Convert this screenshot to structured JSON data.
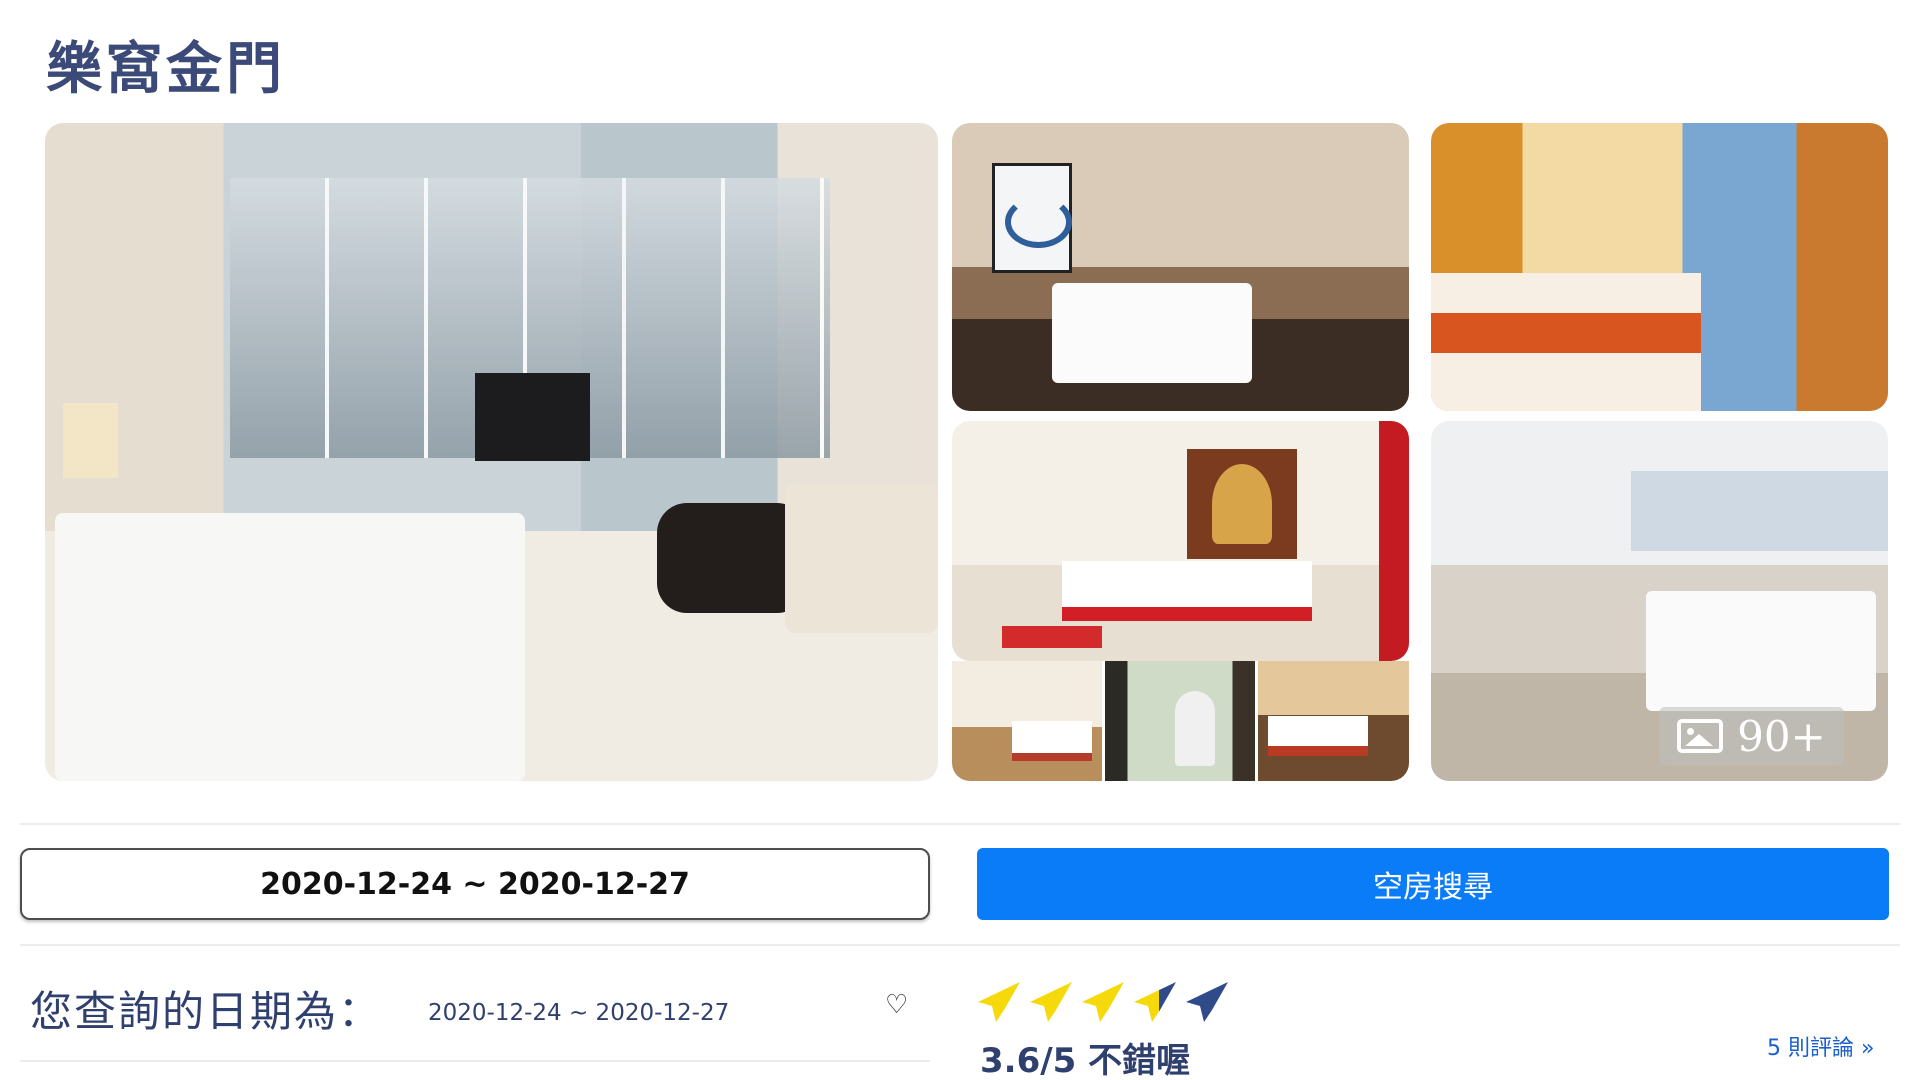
{
  "hotel": {
    "name": "樂窩金門"
  },
  "gallery": {
    "main_photo": "bedroom-city-view",
    "more_count": "90+"
  },
  "search": {
    "date_range": "2020-12-24 ~ 2020-12-27",
    "button_label": "空房搜尋"
  },
  "query": {
    "label": "您查詢的日期為：",
    "range": "2020-12-24 ~ 2020-12-27"
  },
  "rating": {
    "score_text": "3.6/5 不錯喔",
    "score": 3.6,
    "max": 5,
    "reviews_text": "5 則評論 »",
    "active_color": "#f5d90a",
    "inactive_color": "#2f4b8a"
  },
  "colors": {
    "accent": "#0b7cf7",
    "title": "#3b4a78"
  }
}
